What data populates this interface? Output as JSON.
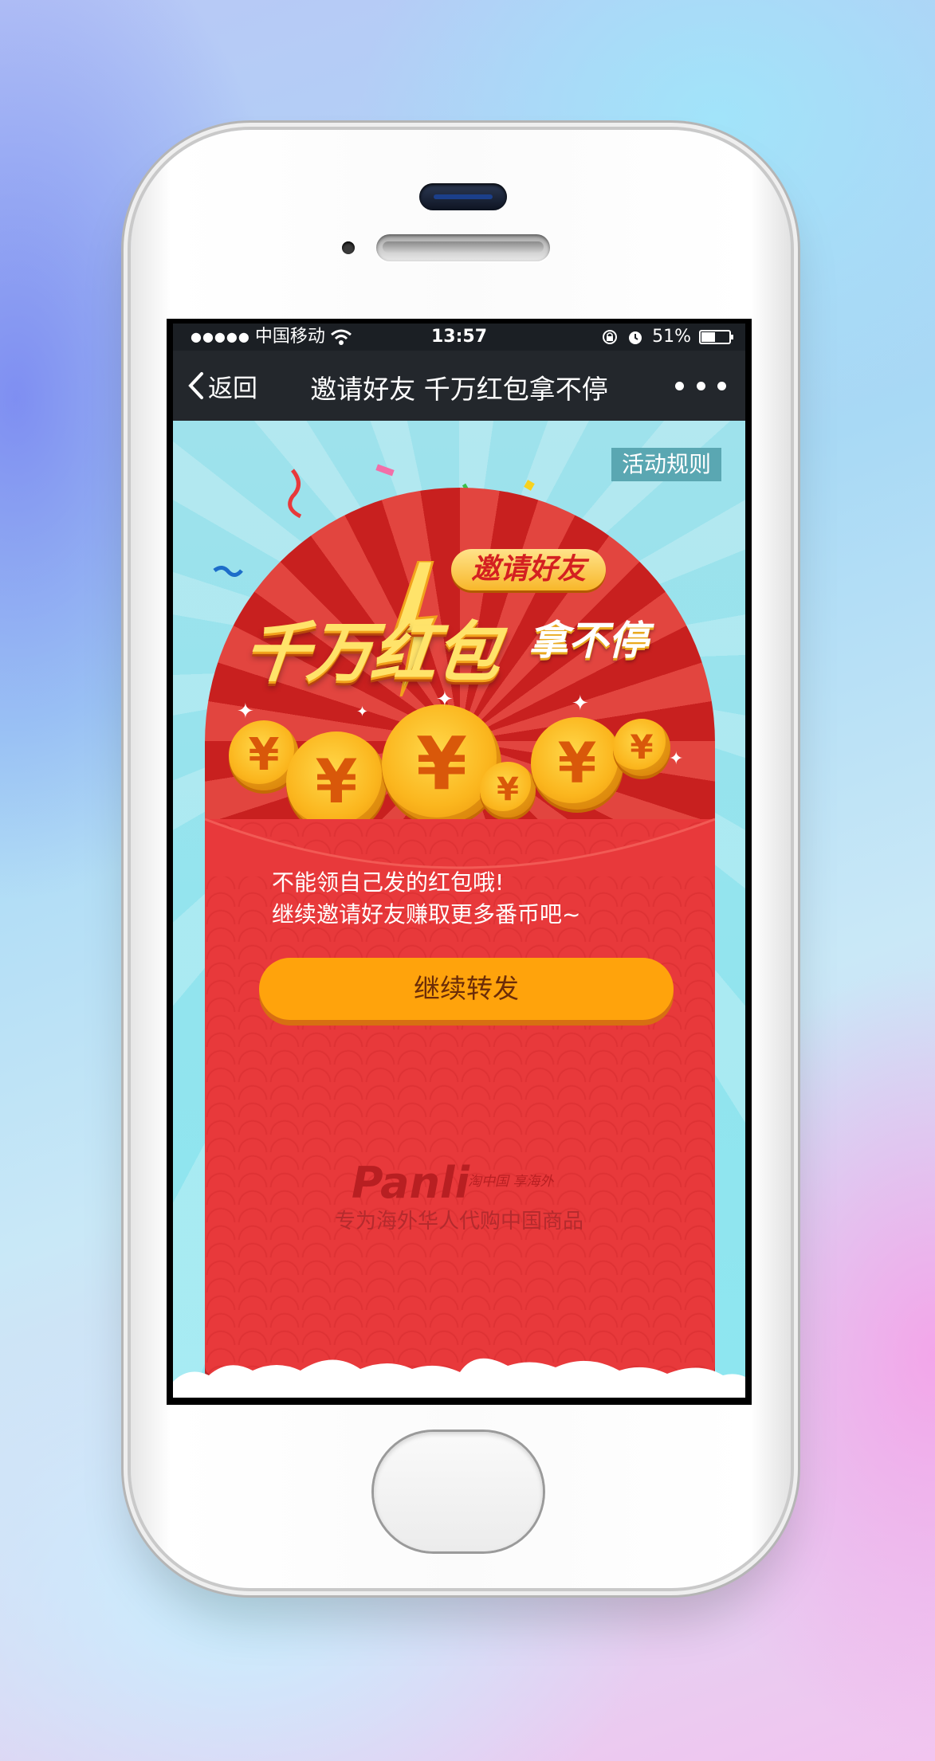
{
  "status_bar": {
    "signal": "●●●●●",
    "carrier": "中国移动",
    "time": "13:57",
    "battery": "51%",
    "battery_level": 0.51
  },
  "nav_bar": {
    "back_label": "返回",
    "title": "邀请好友 千万红包拿不停"
  },
  "page": {
    "rules_label": "活动规则",
    "banner_badge": "邀请好友",
    "banner_title": "千万红包",
    "banner_title_sub": "拿不停",
    "coin_symbol": "¥",
    "message_line1": "不能领自己发的红包哦!",
    "message_line2": "继续邀请好友赚取更多番币吧~",
    "forward_button": "继续转发",
    "brand_logo": "Panli",
    "brand_slogan": "淘中国 享海外",
    "brand_tagline": "专为海外华人代购中国商品"
  },
  "colors": {
    "envelope_red": "#e8393b",
    "button_orange": "#ffa30c",
    "sky_blue": "#92e4ee",
    "nav_dark": "#23272c"
  }
}
